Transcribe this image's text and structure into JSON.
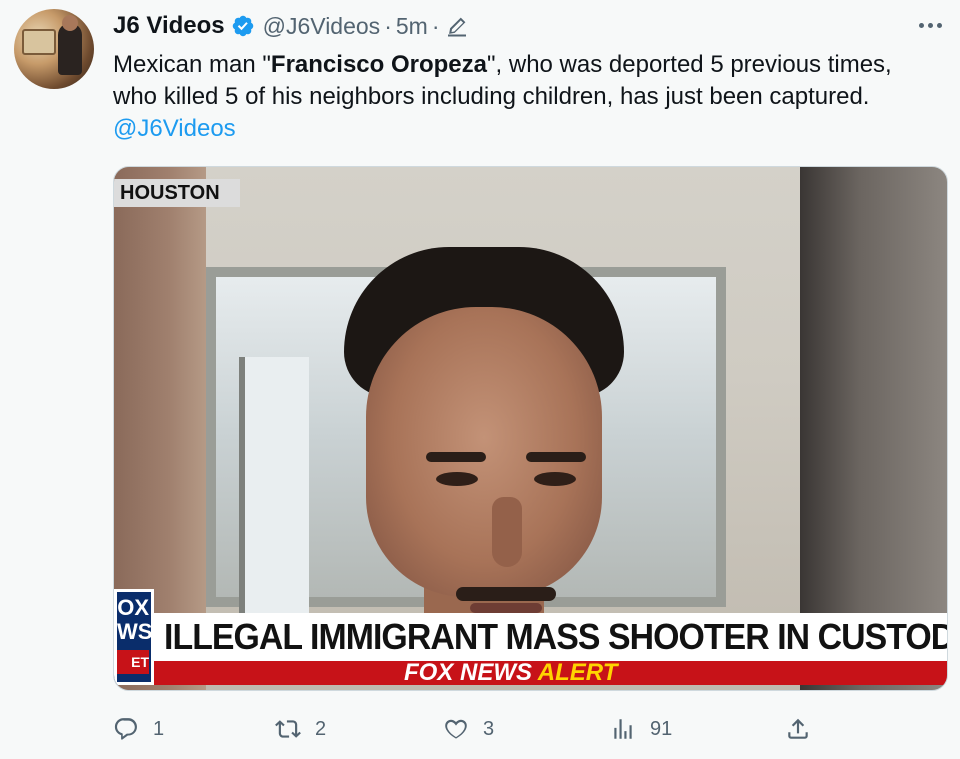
{
  "tweet": {
    "author_name": "J6 Videos",
    "handle": "@J6Videos",
    "separator": "·",
    "time": "5m",
    "time_separator": "·",
    "text_part1": "Mexican man \"",
    "text_bold": "Francisco Oropeza",
    "text_part2": "\", who was deported 5 previous times,",
    "text_line2": "who killed 5 of his neighbors including children, has just been captured.",
    "mention": "@J6Videos"
  },
  "media": {
    "location_tag": "HOUSTON",
    "headline": "ILLEGAL IMMIGRANT MASS SHOOTER IN CUSTODY",
    "alert_brand": "FOX NEWS",
    "alert_word": "ALERT",
    "logo_text": "OX WS",
    "logo_small": "ET"
  },
  "actions": {
    "replies": "1",
    "retweets": "2",
    "likes": "3",
    "views": "91"
  },
  "colors": {
    "accent": "#1d9bf0",
    "muted": "#536471",
    "fox_red": "#c71218",
    "fox_yellow": "#ffd400"
  },
  "icons": [
    "verified-badge-icon",
    "edit-icon",
    "more-icon",
    "reply-icon",
    "retweet-icon",
    "like-icon",
    "views-icon",
    "share-icon"
  ]
}
